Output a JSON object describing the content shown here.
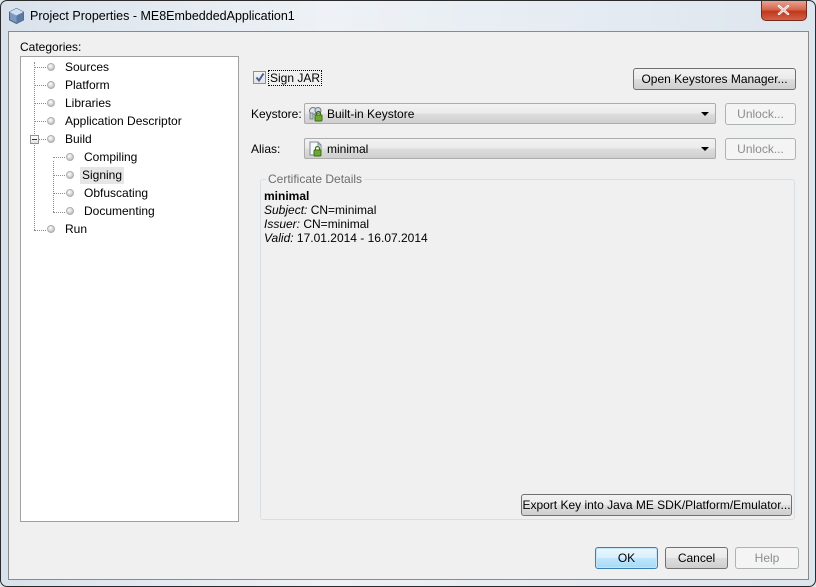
{
  "window": {
    "title": "Project Properties - ME8EmbeddedApplication1",
    "app_icon": "netbeans-cube-icon",
    "close_icon": "close-x-icon"
  },
  "categories": {
    "label": "Categories:",
    "items": [
      {
        "label": "Sources",
        "level": 0
      },
      {
        "label": "Platform",
        "level": 0
      },
      {
        "label": "Libraries",
        "level": 0
      },
      {
        "label": "Application Descriptor",
        "level": 0
      },
      {
        "label": "Build",
        "level": 0,
        "expanded": true
      },
      {
        "label": "Compiling",
        "level": 1
      },
      {
        "label": "Signing",
        "level": 1,
        "selected": true
      },
      {
        "label": "Obfuscating",
        "level": 1
      },
      {
        "label": "Documenting",
        "level": 1
      },
      {
        "label": "Run",
        "level": 0
      }
    ]
  },
  "signing": {
    "sign_jar_label": "Sign JAR",
    "sign_jar_checked": true,
    "open_keystores_label": "Open Keystores Manager...",
    "keystore_label": "Keystore:",
    "keystore_value": "Built-in Keystore",
    "keystore_icon": "keystore-icon",
    "alias_label": "Alias:",
    "alias_value": "minimal",
    "alias_icon": "key-certificate-icon",
    "unlock_keystore_label": "Unlock...",
    "unlock_alias_label": "Unlock..."
  },
  "certificate": {
    "group_title": "Certificate Details",
    "name": "minimal",
    "subject_label": "Subject:",
    "subject_value": " CN=minimal",
    "issuer_label": "Issuer:",
    "issuer_value": " CN=minimal",
    "valid_label": "Valid:",
    "valid_value": " 17.01.2014 - 16.07.2014",
    "export_label": "Export Key into Java ME SDK/Platform/Emulator..."
  },
  "footer": {
    "ok_label": "OK",
    "cancel_label": "Cancel",
    "help_label": "Help"
  }
}
